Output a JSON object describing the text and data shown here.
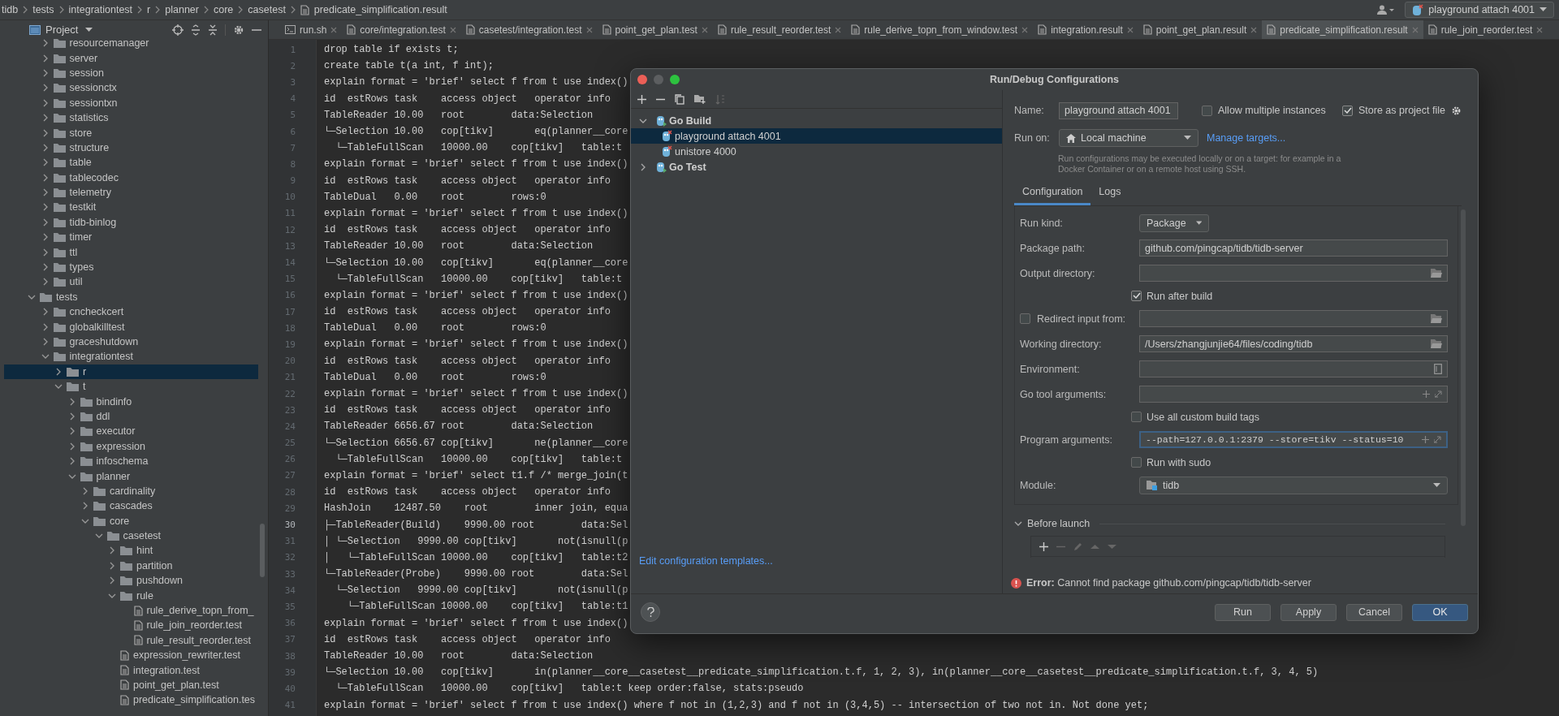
{
  "breadcrumbs": [
    "tidb",
    "tests",
    "integrationtest",
    "r",
    "planner",
    "core",
    "casetest"
  ],
  "breadcrumb_file": "predicate_simplification.result",
  "run_config": "playground attach 4001",
  "project_panel": {
    "title": "Project"
  },
  "tree": [
    {
      "children": [
        {
          "label": "resourcemanager",
          "kind": "folder",
          "expanded": false,
          "selected": false
        },
        {
          "label": "server",
          "kind": "folder",
          "expanded": false,
          "selected": false
        },
        {
          "label": "session",
          "kind": "folder",
          "expanded": false,
          "selected": false
        },
        {
          "label": "sessionctx",
          "kind": "folder",
          "expanded": false,
          "selected": false
        },
        {
          "label": "sessiontxn",
          "kind": "folder",
          "expanded": false,
          "selected": false
        },
        {
          "label": "statistics",
          "kind": "folder",
          "expanded": false,
          "selected": false
        },
        {
          "label": "store",
          "kind": "folder",
          "expanded": false,
          "selected": false
        },
        {
          "label": "structure",
          "kind": "folder",
          "expanded": false,
          "selected": false
        },
        {
          "label": "table",
          "kind": "folder",
          "expanded": false,
          "selected": false
        },
        {
          "label": "tablecodec",
          "kind": "folder",
          "expanded": false,
          "selected": false
        },
        {
          "label": "telemetry",
          "kind": "folder",
          "expanded": false,
          "selected": false
        },
        {
          "label": "testkit",
          "kind": "folder",
          "expanded": false,
          "selected": false
        },
        {
          "label": "tidb-binlog",
          "kind": "folder",
          "expanded": false,
          "selected": false
        },
        {
          "label": "timer",
          "kind": "folder",
          "expanded": false,
          "selected": false
        },
        {
          "label": "ttl",
          "kind": "folder",
          "expanded": false,
          "selected": false
        },
        {
          "label": "types",
          "kind": "folder",
          "expanded": false,
          "selected": false
        },
        {
          "label": "util",
          "kind": "folder",
          "expanded": false,
          "selected": false
        }
      ]
    },
    {
      "label": "tests",
      "kind": "folder",
      "expanded": true,
      "selected": false,
      "children": [
        {
          "label": "cncheckcert",
          "kind": "folder",
          "expanded": false,
          "selected": false
        },
        {
          "label": "globalkilltest",
          "kind": "folder",
          "expanded": false,
          "selected": false
        },
        {
          "label": "graceshutdown",
          "kind": "folder",
          "expanded": false,
          "selected": false
        },
        {
          "label": "integrationtest",
          "kind": "folder",
          "expanded": true,
          "selected": false,
          "children": [
            {
              "label": "r",
              "kind": "folder",
              "expanded": false,
              "selected": true
            },
            {
              "label": "t",
              "kind": "folder",
              "expanded": true,
              "selected": false,
              "children": [
                {
                  "label": "bindinfo",
                  "kind": "folder",
                  "expanded": false,
                  "selected": false
                },
                {
                  "label": "ddl",
                  "kind": "folder",
                  "expanded": false,
                  "selected": false
                },
                {
                  "label": "executor",
                  "kind": "folder",
                  "expanded": false,
                  "selected": false
                },
                {
                  "label": "expression",
                  "kind": "folder",
                  "expanded": false,
                  "selected": false
                },
                {
                  "label": "infoschema",
                  "kind": "folder",
                  "expanded": false,
                  "selected": false
                },
                {
                  "label": "planner",
                  "kind": "folder",
                  "expanded": true,
                  "selected": false,
                  "children": [
                    {
                      "label": "cardinality",
                      "kind": "folder",
                      "expanded": false,
                      "selected": false
                    },
                    {
                      "label": "cascades",
                      "kind": "folder",
                      "expanded": false,
                      "selected": false
                    },
                    {
                      "label": "core",
                      "kind": "folder",
                      "expanded": true,
                      "selected": false,
                      "children": [
                        {
                          "label": "casetest",
                          "kind": "folder",
                          "expanded": true,
                          "selected": false,
                          "children": [
                            {
                              "label": "hint",
                              "kind": "folder",
                              "expanded": false,
                              "selected": false
                            },
                            {
                              "label": "partition",
                              "kind": "folder",
                              "expanded": false,
                              "selected": false
                            },
                            {
                              "label": "pushdown",
                              "kind": "folder",
                              "expanded": false,
                              "selected": false
                            },
                            {
                              "label": "rule",
                              "kind": "folder",
                              "expanded": true,
                              "selected": false,
                              "children": [
                                {
                                  "label": "rule_derive_topn_from_",
                                  "kind": "file",
                                  "selected": false
                                },
                                {
                                  "label": "rule_join_reorder.test",
                                  "kind": "file",
                                  "selected": false
                                },
                                {
                                  "label": "rule_result_reorder.test",
                                  "kind": "file",
                                  "selected": false
                                }
                              ]
                            },
                            {
                              "label": "expression_rewriter.test",
                              "kind": "file",
                              "selected": false
                            },
                            {
                              "label": "integration.test",
                              "kind": "file",
                              "selected": false
                            },
                            {
                              "label": "point_get_plan.test",
                              "kind": "file",
                              "selected": false
                            },
                            {
                              "label": "predicate_simplification.tes",
                              "kind": "file",
                              "selected": false
                            }
                          ]
                        }
                      ]
                    }
                  ]
                }
              ]
            }
          ]
        }
      ]
    }
  ],
  "tabs": [
    {
      "label": "run.sh",
      "kind": "script",
      "selected": false
    },
    {
      "label": "core/integration.test",
      "kind": "file",
      "selected": false
    },
    {
      "label": "casetest/integration.test",
      "kind": "file",
      "selected": false
    },
    {
      "label": "point_get_plan.test",
      "kind": "file",
      "selected": false
    },
    {
      "label": "rule_result_reorder.test",
      "kind": "file",
      "selected": false
    },
    {
      "label": "rule_derive_topn_from_window.test",
      "kind": "file",
      "selected": false
    },
    {
      "label": "integration.result",
      "kind": "file",
      "selected": false
    },
    {
      "label": "point_get_plan.result",
      "kind": "file",
      "selected": false
    },
    {
      "label": "predicate_simplification.result",
      "kind": "file",
      "selected": true
    },
    {
      "label": "rule_join_reorder.test",
      "kind": "file",
      "selected": false
    }
  ],
  "editor": {
    "lines": [
      {
        "number": "1",
        "text": "drop table if exists t;",
        "current": false
      },
      {
        "number": "2",
        "text": "create table t(a int, f int);",
        "current": false
      },
      {
        "number": "3",
        "text": "explain format = 'brief' select f from t use index()",
        "current": false
      },
      {
        "number": "4",
        "text": "id  estRows task    access object   operator info",
        "current": false
      },
      {
        "number": "5",
        "text": "TableReader 10.00   root        data:Selection",
        "current": false
      },
      {
        "number": "6",
        "text": "└─Selection 10.00   cop[tikv]       eq(planner__core",
        "current": false
      },
      {
        "number": "7",
        "text": "  └─TableFullScan   10000.00    cop[tikv]   table:t",
        "current": false
      },
      {
        "number": "8",
        "text": "explain format = 'brief' select f from t use index()",
        "current": false
      },
      {
        "number": "9",
        "text": "id  estRows task    access object   operator info",
        "current": false
      },
      {
        "number": "10",
        "text": "TableDual   0.00    root        rows:0",
        "current": false
      },
      {
        "number": "11",
        "text": "explain format = 'brief' select f from t use index()",
        "current": false
      },
      {
        "number": "12",
        "text": "id  estRows task    access object   operator info",
        "current": false
      },
      {
        "number": "13",
        "text": "TableReader 10.00   root        data:Selection",
        "current": false
      },
      {
        "number": "14",
        "text": "└─Selection 10.00   cop[tikv]       eq(planner__core",
        "current": false
      },
      {
        "number": "15",
        "text": "  └─TableFullScan   10000.00    cop[tikv]   table:t",
        "current": false
      },
      {
        "number": "16",
        "text": "explain format = 'brief' select f from t use index()",
        "current": false
      },
      {
        "number": "17",
        "text": "id  estRows task    access object   operator info",
        "current": false
      },
      {
        "number": "18",
        "text": "TableDual   0.00    root        rows:0",
        "current": false
      },
      {
        "number": "19",
        "text": "explain format = 'brief' select f from t use index()",
        "current": false
      },
      {
        "number": "20",
        "text": "id  estRows task    access object   operator info",
        "current": false
      },
      {
        "number": "21",
        "text": "TableDual   0.00    root        rows:0",
        "current": false
      },
      {
        "number": "22",
        "text": "explain format = 'brief' select f from t use index()",
        "current": false
      },
      {
        "number": "23",
        "text": "id  estRows task    access object   operator info",
        "current": false
      },
      {
        "number": "24",
        "text": "TableReader 6656.67 root        data:Selection",
        "current": false
      },
      {
        "number": "25",
        "text": "└─Selection 6656.67 cop[tikv]       ne(planner__core",
        "current": false
      },
      {
        "number": "26",
        "text": "  └─TableFullScan   10000.00    cop[tikv]   table:t",
        "current": false
      },
      {
        "number": "27",
        "text": "explain format = 'brief' select t1.f /* merge_join(t",
        "current": false
      },
      {
        "number": "28",
        "text": "id  estRows task    access object   operator info",
        "current": false
      },
      {
        "number": "29",
        "text": "HashJoin    12487.50    root        inner join, equa",
        "current": false
      },
      {
        "number": "30",
        "text": "├─TableReader(Build)    9990.00 root        data:Sel",
        "current": true
      },
      {
        "number": "31",
        "text": "│ └─Selection   9990.00 cop[tikv]       not(isnull(p",
        "current": false
      },
      {
        "number": "32",
        "text": "│   └─TableFullScan 10000.00    cop[tikv]   table:t2",
        "current": false
      },
      {
        "number": "33",
        "text": "└─TableReader(Probe)    9990.00 root        data:Sel",
        "current": false
      },
      {
        "number": "34",
        "text": "  └─Selection   9990.00 cop[tikv]       not(isnull(p",
        "current": false
      },
      {
        "number": "35",
        "text": "    └─TableFullScan 10000.00    cop[tikv]   table:t1",
        "current": false
      },
      {
        "number": "36",
        "text": "explain format = 'brief' select f from t use index()",
        "current": false
      },
      {
        "number": "37",
        "text": "id  estRows task    access object   operator info",
        "current": false
      },
      {
        "number": "38",
        "text": "TableReader 10.00   root        data:Selection",
        "current": false
      },
      {
        "number": "39",
        "text": "└─Selection 10.00   cop[tikv]       in(planner__core__casetest__predicate_simplification.t.f, 1, 2, 3), in(planner__core__casetest__predicate_simplification.t.f, 3, 4, 5)",
        "current": false
      },
      {
        "number": "40",
        "text": "  └─TableFullScan   10000.00    cop[tikv]   table:t keep order:false, stats:pseudo",
        "current": false
      },
      {
        "number": "41",
        "text": "explain format = 'brief' select f from t use index() where f not in (1,2,3) and f not in (3,4,5) -- intersection of two not in. Not done yet;",
        "current": false
      }
    ]
  },
  "dialog": {
    "title": "Run/Debug Configurations",
    "config_tree": [
      {
        "label": "Go Build",
        "expanded": true,
        "selected": false,
        "children": [
          {
            "label": "playground attach 4001",
            "selected": true
          },
          {
            "label": "unistore 4000",
            "selected": false
          }
        ]
      },
      {
        "label": "Go Test",
        "expanded": false,
        "selected": false
      }
    ],
    "templates_link": "Edit configuration templates...",
    "name": {
      "label": "Name:",
      "value": "playground attach 4001"
    },
    "allow_multiple": {
      "label": "Allow multiple instances",
      "checked": false
    },
    "store_as_project": {
      "label": "Store as project file",
      "checked": true
    },
    "run_on": {
      "label": "Run on:",
      "value": "Local machine"
    },
    "manage_link": "Manage targets...",
    "run_on_hint": "Run configurations may be executed locally or on a target: for example in a Docker Container or on a remote host using SSH.",
    "tabs": [
      {
        "label": "Configuration",
        "selected": true
      },
      {
        "label": "Logs",
        "selected": false
      }
    ],
    "fields": [
      {
        "kind": "dropdown",
        "label": "Run kind:",
        "value": "Package"
      },
      {
        "kind": "text",
        "label": "Package path:",
        "value": "github.com/pingcap/tidb/tidb-server"
      },
      {
        "kind": "browse",
        "label": "Output directory:"
      },
      {
        "kind": "checkbox",
        "label": "Run after build",
        "checked": true
      },
      {
        "kind": "check_browse",
        "label": "Redirect input from:",
        "checked": false
      },
      {
        "kind": "browse",
        "label": "Working directory:",
        "value": "/Users/zhangjunjie64/files/coding/tidb"
      },
      {
        "kind": "env",
        "label": "Environment:"
      },
      {
        "kind": "expand",
        "label": "Go tool arguments:",
        "focused": false
      },
      {
        "kind": "checkbox",
        "label": "Use all custom build tags",
        "checked": false
      },
      {
        "kind": "expand",
        "label": "Program arguments:",
        "value": "--path=127.0.0.1:2379 --store=tikv --status=10",
        "focused": true
      },
      {
        "kind": "checkbox",
        "label": "Run with sudo",
        "checked": false
      },
      {
        "kind": "module",
        "label": "Module:",
        "value": "tidb"
      }
    ],
    "before_launch": {
      "label": "Before launch",
      "expanded": true
    },
    "error": "**Error:** Cannot find package github.com/pingcap/tidb/tidb-server",
    "buttons": [
      {
        "label": "Run",
        "default": false
      },
      {
        "label": "Apply",
        "default": false
      },
      {
        "label": "Cancel",
        "default": false
      },
      {
        "label": "OK",
        "default": true
      }
    ]
  }
}
